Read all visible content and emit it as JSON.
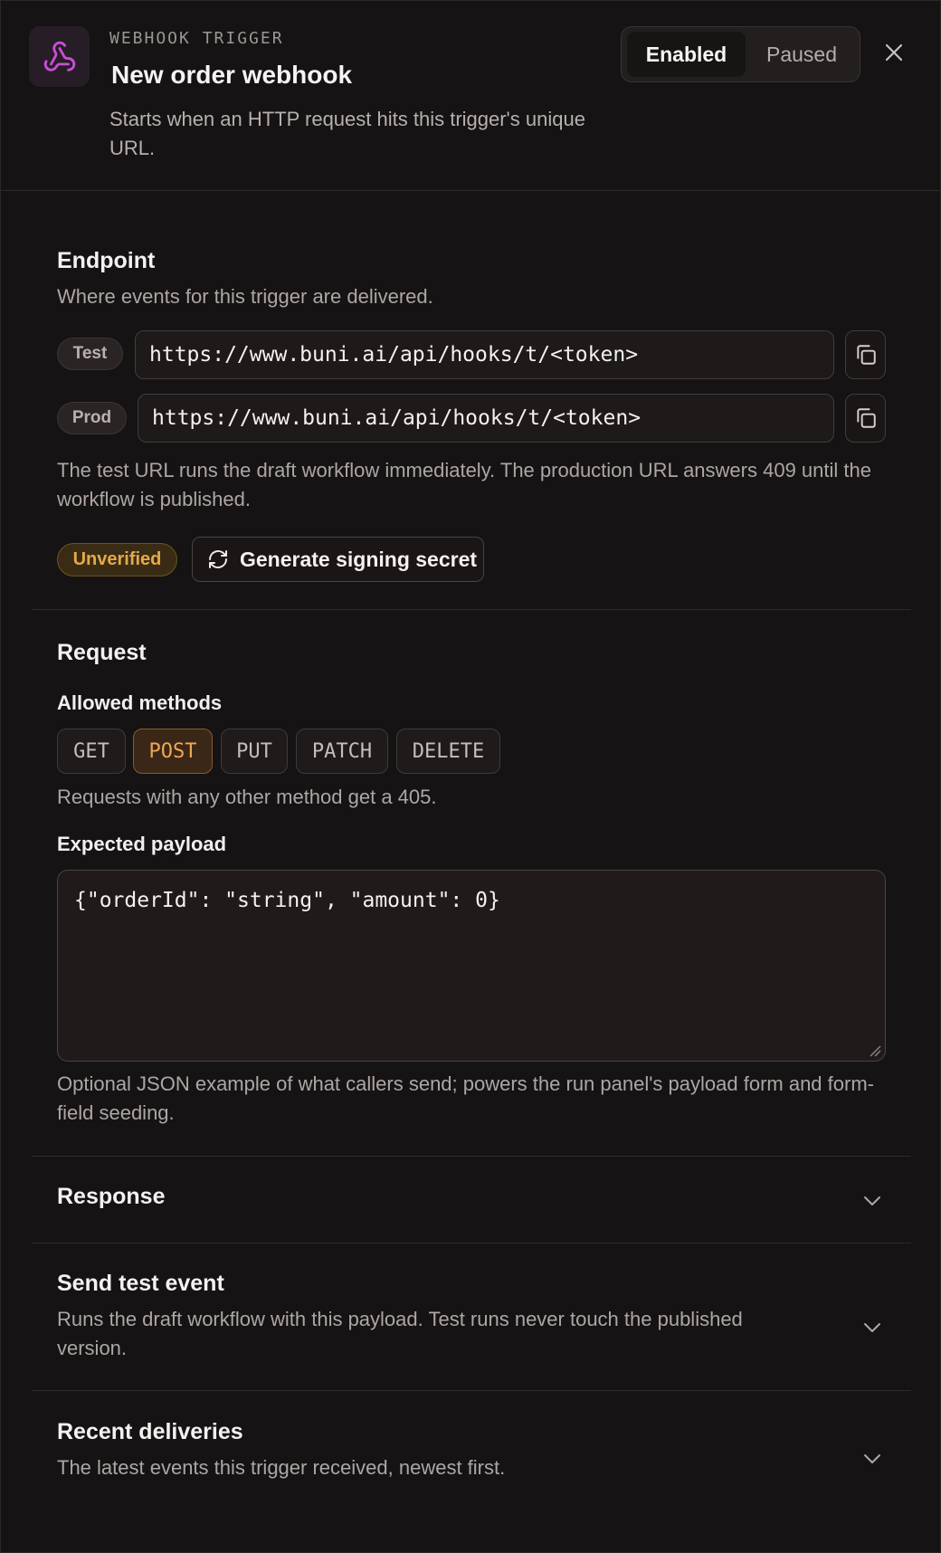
{
  "header": {
    "eyebrow": "WEBHOOK TRIGGER",
    "title": "New order webhook",
    "subtitle": "Starts when an HTTP request hits this trigger's unique URL.",
    "status_toggle": {
      "enabled_label": "Enabled",
      "paused_label": "Paused",
      "selected": "Enabled"
    },
    "icons": {
      "app": "webhook-icon",
      "close": "close-icon"
    },
    "accent_color": "#c94fd6"
  },
  "endpoint": {
    "title": "Endpoint",
    "description": "Where events for this trigger are delivered.",
    "urls": [
      {
        "env": "Test",
        "url": "https://www.buni.ai/api/hooks/t/<token>"
      },
      {
        "env": "Prod",
        "url": "https://www.buni.ai/api/hooks/t/<token>"
      }
    ],
    "note": "The test URL runs the draft workflow immediately. The production URL answers 409 until the workflow is published.",
    "verification_badge": "Unverified",
    "generate_secret_label": "Generate signing secret"
  },
  "request": {
    "title": "Request",
    "allowed_methods_label": "Allowed methods",
    "methods": [
      {
        "name": "GET",
        "selected": false
      },
      {
        "name": "POST",
        "selected": true
      },
      {
        "name": "PUT",
        "selected": false
      },
      {
        "name": "PATCH",
        "selected": false
      },
      {
        "name": "DELETE",
        "selected": false
      }
    ],
    "methods_note": "Requests with any other method get a 405.",
    "payload_label": "Expected payload",
    "payload_value": "{\"orderId\": \"string\", \"amount\": 0}",
    "payload_note": "Optional JSON example of what callers send; powers the run panel's payload form and form-field seeding."
  },
  "collapsibles": {
    "response": {
      "title": "Response"
    },
    "send_test": {
      "title": "Send test event",
      "description": "Runs the draft workflow with this payload. Test runs never touch the published version."
    },
    "recent": {
      "title": "Recent deliveries",
      "description": "The latest events this trigger received, newest first."
    }
  }
}
